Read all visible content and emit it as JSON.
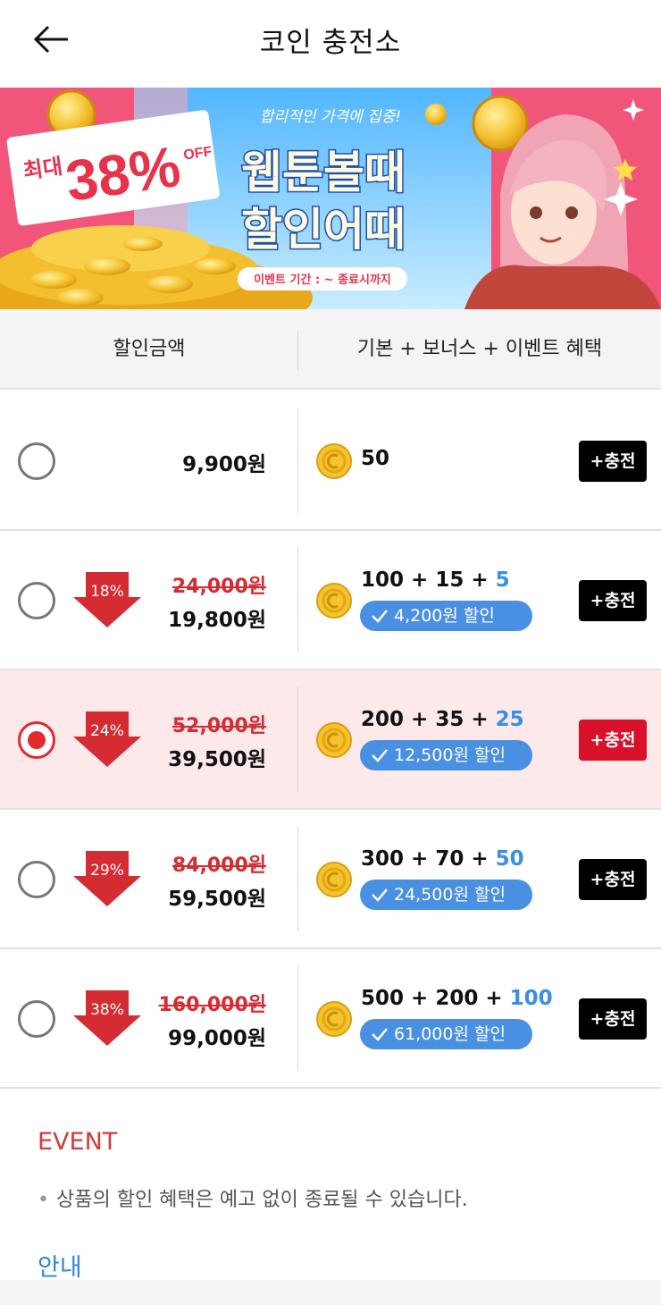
{
  "header": {
    "title": "코인 충전소"
  },
  "banner": {
    "max_label": "최대",
    "percent": "38%",
    "off": "OFF",
    "slogan": "합리적인 가격에 집중!",
    "line1": "웹툰볼때",
    "line2": "할인어때",
    "period": "이벤트 기간 : ~ 종료시까지"
  },
  "table_header": {
    "left": "할인금액",
    "right": "기본 + 보너스 + 이벤트 혜택"
  },
  "rows": [
    {
      "selected": false,
      "discount_pct": "",
      "original_price": "",
      "price": "9,900원",
      "base": "50",
      "bonus": "",
      "event": "",
      "saving": "",
      "charge_label": "+충전"
    },
    {
      "selected": false,
      "discount_pct": "18%",
      "original_price": "24,000원",
      "price": "19,800원",
      "base": "100",
      "bonus": "15",
      "event": "5",
      "saving": "4,200원 할인",
      "charge_label": "+충전"
    },
    {
      "selected": true,
      "discount_pct": "24%",
      "original_price": "52,000원",
      "price": "39,500원",
      "base": "200",
      "bonus": "35",
      "event": "25",
      "saving": "12,500원 할인",
      "charge_label": "+충전"
    },
    {
      "selected": false,
      "discount_pct": "29%",
      "original_price": "84,000원",
      "price": "59,500원",
      "base": "300",
      "bonus": "70",
      "event": "50",
      "saving": "24,500원 할인",
      "charge_label": "+충전"
    },
    {
      "selected": false,
      "discount_pct": "38%",
      "original_price": "160,000원",
      "price": "99,000원",
      "base": "500",
      "bonus": "200",
      "event": "100",
      "saving": "61,000원 할인",
      "charge_label": "+충전"
    }
  ],
  "event": {
    "title": "EVENT",
    "note": "상품의 할인 혜택은 예고 없이 종료될 수 있습니다."
  },
  "info": {
    "title": "안내"
  },
  "colors": {
    "accent_red": "#d9102a",
    "event_blue": "#3a8ee6",
    "selected_row_bg": "#fde8ea",
    "banner_pink": "#f2557a"
  },
  "icons": {
    "back": "arrow-left-icon",
    "coin": "coin-icon",
    "check": "check-icon",
    "discount": "down-arrow-icon"
  }
}
